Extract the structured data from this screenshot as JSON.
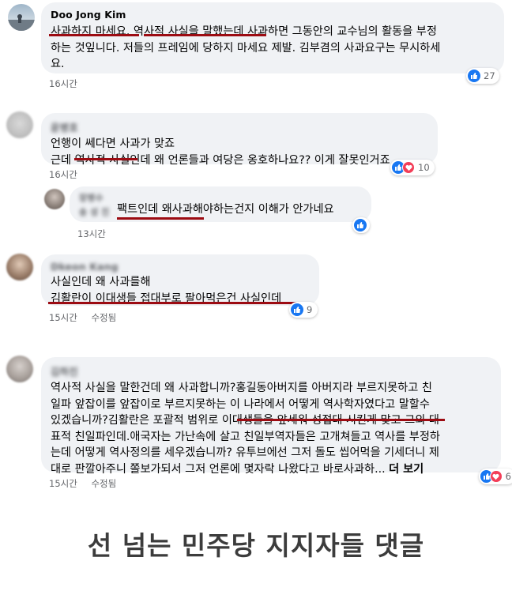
{
  "comments": [
    {
      "author": "Doo Jong Kim",
      "text": "사과하지 마세요. 역사적 사실을 말했는데 사과하면 그동안의 교수님의 활동을 부정\n하는 것잎니다. 저들의 프레임에 당하지 마세요 제발. 김부겸의 사과요구는 무시하세\n요.",
      "time": "16시간",
      "reaction_count": "27"
    },
    {
      "author": "윤병호",
      "text": "언행이 쎄다면 사과가 맞죠\n근데 역사적 사실인데 왜 언론들과 여당은 옹호하나요?? 이게 잘못인거죠",
      "time": "16시간",
      "reaction_count": "10"
    },
    {
      "author": "장병수",
      "author_line2": "송 성 진",
      "text": "팩트인데 왜사과해야하는건지 이해가 안가네요",
      "time": "13시간"
    },
    {
      "author": "Dkeon Kang",
      "text": "사실인데 왜 사과를해\n김활란이 이대생들 접대부로 팔아먹은건 사실인데",
      "time": "15시간",
      "edited": "수정됨",
      "reaction_count": "9"
    },
    {
      "author": "김하진",
      "text": "역사적 사실을 말한건데 왜 사과합니까?홍길동아버지를 아버지라 부르지못하고 친\n일파 앞잡이를 앞잡이로 부르지못하는 이 나라에서 어떻게 역사학자였다고 말할수\n있겠습니까?김활란은 포괄적 범위로 이대생들을 앞세워 성접대 시킨게 맞고 그외 대\n표적 친일파인데.애국자는 가난속에 살고 친일부역자들은 고개쳐들고 역사를 부정하\n는데 어떻게 역사정의를 세우겠습니까? 유투브에선 그저 돌도 씹어먹을 기세더니 제\n대로 판깔아주니 쫄보가되서 그저 언론에 몇자락 나왔다고 바로사과하... ",
      "more": "더 보기",
      "time": "15시간",
      "edited": "수정됨",
      "reaction_count": "6"
    }
  ],
  "caption": "선 넘는 민주당 지지자들 댓글",
  "colors": {
    "underline": "#9c0b12",
    "bubble": "#f0f2f5",
    "like": "#1877f2",
    "love": "#f33e58"
  }
}
